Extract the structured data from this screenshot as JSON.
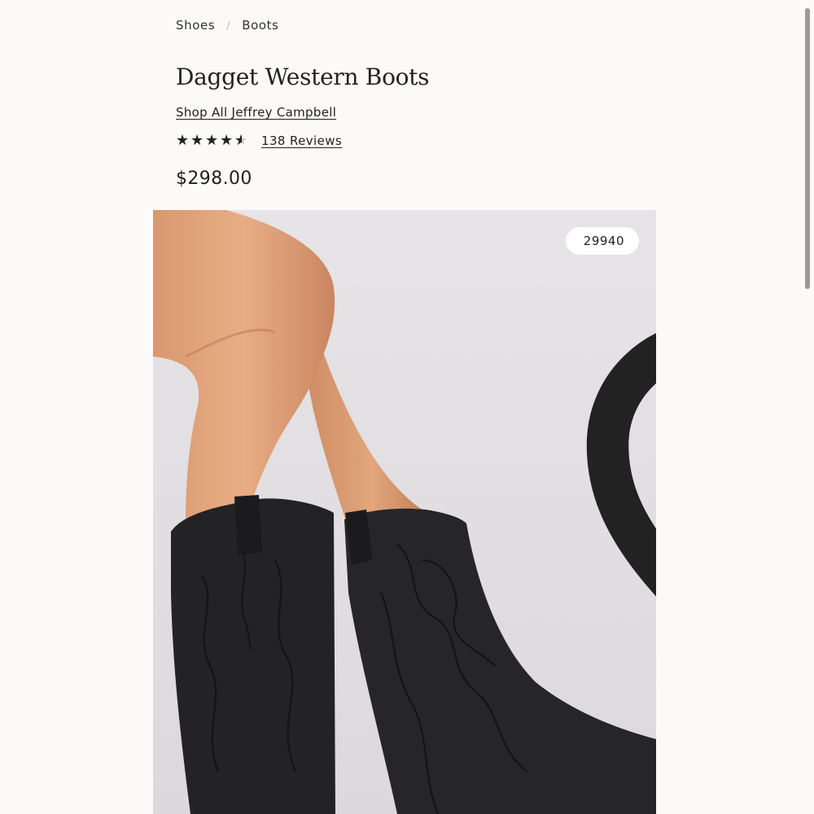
{
  "breadcrumb": {
    "items": [
      "Shoes",
      "Boots"
    ],
    "separator": "/"
  },
  "product": {
    "title": "Dagget Western Boots",
    "brand_link": "Shop All Jeffrey Campbell",
    "rating": 4.5,
    "reviews_label": "138 Reviews",
    "price": "$298.00"
  },
  "wishlist": {
    "count": "29940",
    "icon": "heart-icon"
  },
  "colors": {
    "background": "#fcfaf8",
    "text": "#222222",
    "image_bg": "#e0dde0"
  }
}
